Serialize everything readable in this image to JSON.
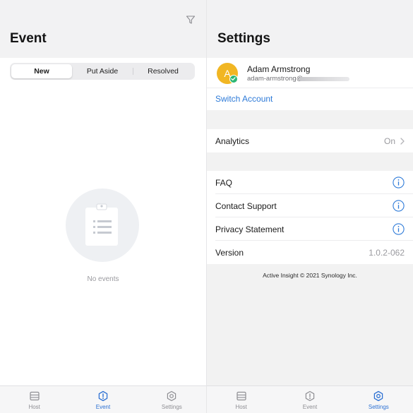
{
  "event_screen": {
    "title": "Event",
    "icons": {
      "filter": "filter-icon"
    },
    "segments": [
      {
        "label": "New",
        "selected": true
      },
      {
        "label": "Put Aside",
        "selected": false
      },
      {
        "label": "Resolved",
        "selected": false
      }
    ],
    "empty_state": {
      "icon": "clipboard-icon",
      "text": "No events"
    },
    "tabbar": [
      {
        "label": "Host",
        "icon": "host-icon",
        "active": false
      },
      {
        "label": "Event",
        "icon": "event-icon",
        "active": true
      },
      {
        "label": "Settings",
        "icon": "settings-icon",
        "active": false
      }
    ]
  },
  "settings_screen": {
    "title": "Settings",
    "account": {
      "avatar_initial": "A",
      "name": "Adam Armstrong",
      "email_visible": "adam-armstrong@",
      "switch_label": "Switch Account"
    },
    "analytics": {
      "label": "Analytics",
      "value": "On"
    },
    "info_rows": [
      {
        "label": "FAQ"
      },
      {
        "label": "Contact Support"
      },
      {
        "label": "Privacy Statement"
      }
    ],
    "version": {
      "label": "Version",
      "value": "1.0.2-062"
    },
    "footer": "Active Insight © 2021 Synology Inc.",
    "tabbar": [
      {
        "label": "Host",
        "icon": "host-icon",
        "active": false
      },
      {
        "label": "Event",
        "icon": "event-icon",
        "active": false
      },
      {
        "label": "Settings",
        "icon": "settings-icon",
        "active": true
      }
    ]
  },
  "colors": {
    "accent": "#2d71d3",
    "link": "#2d7ad8",
    "avatar": "#f1b623",
    "online_badge": "#2bb673",
    "muted_text": "#9a9a9f"
  }
}
